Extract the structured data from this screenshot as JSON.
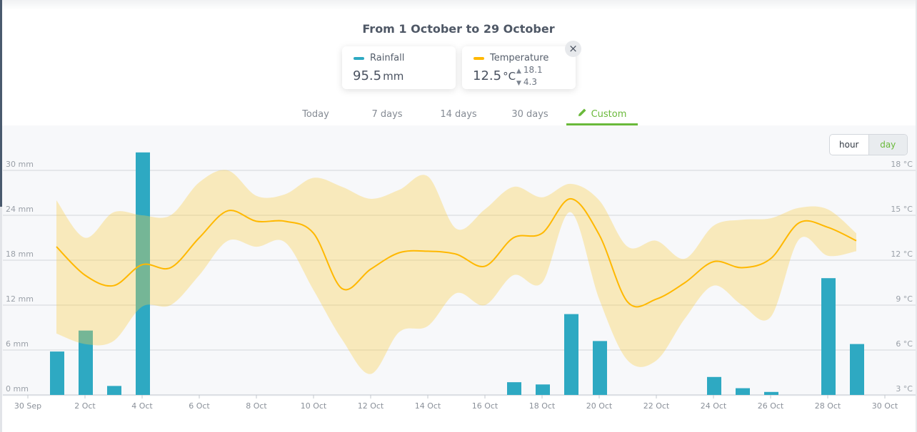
{
  "header": {
    "title": "From 1 October to 29 October"
  },
  "summary": {
    "rainfall": {
      "label": "Rainfall",
      "value": "95.5",
      "unit": "mm",
      "color": "#2ea9c2"
    },
    "temperature": {
      "label": "Temperature",
      "value": "12.5",
      "unit": "°C",
      "max": "18.1",
      "min": "4.3",
      "color": "#ffb800"
    },
    "close_icon": "×"
  },
  "tabs": [
    {
      "label": "Today",
      "active": false
    },
    {
      "label": "7 days",
      "active": false
    },
    {
      "label": "14 days",
      "active": false
    },
    {
      "label": "30 days",
      "active": false
    },
    {
      "label": "Custom",
      "active": true,
      "icon": "pencil-icon"
    }
  ],
  "resolution_toggle": {
    "options": [
      "hour",
      "day"
    ],
    "selected": "day"
  },
  "chart_data": {
    "type": "bar+line+area",
    "grid": true,
    "x_tick_labels": [
      "30 Sep",
      "2 Oct",
      "4 Oct",
      "6 Oct",
      "8 Oct",
      "10 Oct",
      "12 Oct",
      "14 Oct",
      "16 Oct",
      "18 Oct",
      "20 Oct",
      "22 Oct",
      "24 Oct",
      "26 Oct",
      "28 Oct",
      "30 Oct"
    ],
    "y_left": {
      "unit": "mm",
      "range": [
        0,
        30
      ],
      "tick_labels": [
        "0 mm",
        "6 mm",
        "12 mm",
        "18 mm",
        "24 mm",
        "30 mm"
      ]
    },
    "y_right": {
      "unit": "°C",
      "range": [
        3,
        18
      ],
      "tick_labels": [
        "3 °C",
        "6 °C",
        "9 °C",
        "12 °C",
        "15 °C",
        "18 °C"
      ]
    },
    "days": [
      "1 Oct",
      "2 Oct",
      "3 Oct",
      "4 Oct",
      "5 Oct",
      "6 Oct",
      "7 Oct",
      "8 Oct",
      "9 Oct",
      "10 Oct",
      "11 Oct",
      "12 Oct",
      "13 Oct",
      "14 Oct",
      "15 Oct",
      "16 Oct",
      "17 Oct",
      "18 Oct",
      "19 Oct",
      "20 Oct",
      "21 Oct",
      "22 Oct",
      "23 Oct",
      "24 Oct",
      "25 Oct",
      "26 Oct",
      "27 Oct",
      "28 Oct",
      "29 Oct"
    ],
    "series": [
      {
        "kind": "bar",
        "axis": "left",
        "color": "#2ea9c2",
        "values": [
          5.8,
          8.6,
          1.2,
          32.4,
          0,
          0,
          0,
          0,
          0,
          0,
          0,
          0,
          0,
          0,
          0,
          0,
          1.7,
          1.4,
          10.8,
          7.2,
          0,
          0,
          0,
          2.4,
          0.9,
          0.4,
          0,
          15.6,
          6.8
        ]
      },
      {
        "kind": "line",
        "axis": "right",
        "color": "#ffb800",
        "values": [
          12.9,
          11.0,
          10.3,
          11.7,
          11.5,
          13.5,
          15.3,
          14.6,
          14.6,
          13.8,
          10.1,
          11.4,
          12.5,
          12.6,
          12.4,
          11.6,
          13.5,
          13.8,
          16.1,
          13.7,
          9.2,
          9.4,
          10.5,
          11.9,
          11.5,
          12.1,
          14.5,
          14.2,
          13.3
        ]
      },
      {
        "kind": "range",
        "axis": "right",
        "color": "#f8e4a8",
        "max": [
          16.0,
          13.5,
          15.2,
          15.0,
          15.0,
          17.2,
          18.0,
          16.3,
          16.4,
          17.5,
          16.9,
          16.1,
          16.7,
          17.6,
          14.1,
          15.4,
          16.9,
          16.2,
          17.1,
          16.0,
          12.9,
          13.3,
          12.1,
          14.3,
          14.7,
          14.8,
          15.5,
          15.4,
          13.8
        ],
        "min": [
          7.1,
          6.4,
          6.6,
          8.9,
          9.0,
          11.0,
          13.3,
          12.9,
          13.2,
          10.0,
          6.7,
          4.4,
          7.2,
          7.6,
          9.8,
          9.0,
          11.0,
          10.5,
          15.2,
          9.4,
          5.3,
          5.3,
          8.1,
          10.3,
          9.0,
          8.2,
          13.4,
          12.3,
          12.6
        ]
      }
    ]
  }
}
